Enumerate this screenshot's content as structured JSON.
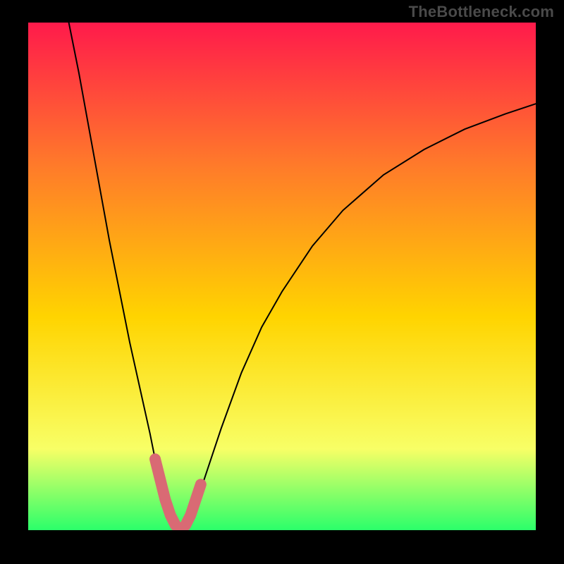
{
  "attribution": "TheBottleneck.com",
  "palette": {
    "frame_bg": "#000000",
    "gradient_top": "#ff1a4b",
    "gradient_mid1": "#ff7a2a",
    "gradient_mid2": "#ffd400",
    "gradient_mid3": "#f8ff66",
    "gradient_bottom": "#2bff6a",
    "curve": "#000000",
    "highlight": "#d96a74"
  },
  "chart_data": {
    "type": "line",
    "title": "",
    "xlabel": "",
    "ylabel": "",
    "xlim": [
      0,
      100
    ],
    "ylim": [
      0,
      100
    ],
    "grid": false,
    "legend": false,
    "series": [
      {
        "name": "bottleneck_curve",
        "x": [
          8,
          10,
          12,
          14,
          16,
          18,
          20,
          22,
          24,
          25,
          26,
          27,
          28,
          29,
          30,
          31,
          32,
          34,
          36,
          38,
          42,
          46,
          50,
          56,
          62,
          70,
          78,
          86,
          94,
          100
        ],
        "y": [
          100,
          90,
          79,
          68,
          57,
          47,
          37,
          28,
          19,
          14,
          10,
          6,
          3,
          1,
          0,
          1,
          3,
          8,
          14,
          20,
          31,
          40,
          47,
          56,
          63,
          70,
          75,
          79,
          82,
          84
        ]
      },
      {
        "name": "highlight_segment",
        "x": [
          25,
          26,
          27,
          28,
          29,
          30,
          31,
          32,
          33,
          34
        ],
        "y": [
          14,
          10,
          6,
          3,
          1,
          0,
          1,
          3,
          6,
          9
        ]
      }
    ],
    "annotations": []
  }
}
